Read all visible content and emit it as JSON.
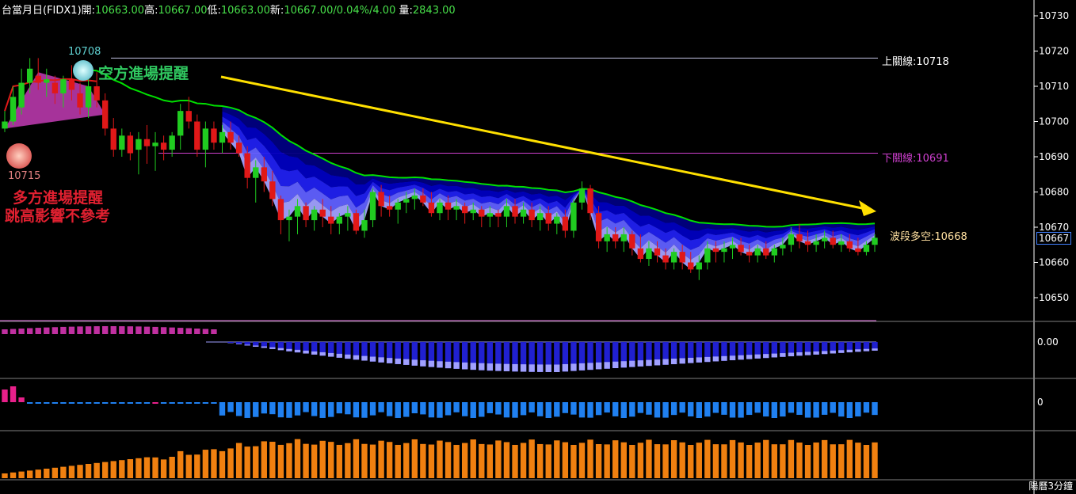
{
  "header": {
    "title": "台當月日(FIDX1)",
    "open_label": "開:",
    "open": "10663.00",
    "high_label": "高:",
    "high": "10667.00",
    "low_label": "低:",
    "low": "10663.00",
    "new_label": "新:",
    "new": "10667.00/0.04%/4.00",
    "vol_label": "量:",
    "vol": "2843.00"
  },
  "annotations": {
    "short_alert": "空方進場提醒",
    "short_price": "10708",
    "long_alert_line1": "多方進場提醒",
    "long_alert_line2": "跳高影響不參考",
    "long_price": "10715",
    "upper_line": "上關線:10718",
    "lower_line": "下關線:10691",
    "wave": "波段多空:10668",
    "current_price": "10667"
  },
  "footer": {
    "mode": "陽曆3分鐘"
  },
  "colors": {
    "bull": "#20cc20",
    "bear": "#e01818",
    "trend": "#ffe000",
    "ma": "#00e000",
    "upper": "#c0c0e0",
    "lower": "#d040d0",
    "hist_pos": "#e8208a",
    "hist_neg": "#2080f0",
    "volume": "#f08010"
  },
  "chart_data": {
    "type": "candlestick",
    "yticks": [
      10730,
      10720,
      10710,
      10700,
      10690,
      10680,
      10670,
      10660,
      10650
    ],
    "ylim": [
      10642,
      10733
    ],
    "osc_tick": "0.00",
    "hist_tick": "0",
    "upper_level": 10718,
    "lower_level": 10691,
    "wave_level": 10668,
    "current": 10667,
    "wave_label_price": 10668,
    "trend": {
      "from_index": 60,
      "from_price": 10713,
      "to_index": 1105,
      "to_price": 10672
    },
    "candles": [
      [
        10698,
        10703,
        10697,
        10700
      ],
      [
        10700,
        10710,
        10699,
        10707
      ],
      [
        10704,
        10715,
        10702,
        10711
      ],
      [
        10711,
        10718,
        10708,
        10715
      ],
      [
        10713,
        10718,
        10709,
        10711
      ],
      [
        10711,
        10715,
        10707,
        10712
      ],
      [
        10711,
        10713,
        10705,
        10708
      ],
      [
        10708,
        10713,
        10704,
        10712
      ],
      [
        10712,
        10716,
        10706,
        10709
      ],
      [
        10708,
        10711,
        10702,
        10704
      ],
      [
        10704,
        10712,
        10701,
        10710
      ],
      [
        10710,
        10714,
        10704,
        10706
      ],
      [
        10706,
        10708,
        10696,
        10698
      ],
      [
        10698,
        10701,
        10690,
        10692
      ],
      [
        10692,
        10698,
        10690,
        10696
      ],
      [
        10696,
        10697,
        10689,
        10691
      ],
      [
        10692,
        10697,
        10685,
        10695
      ],
      [
        10695,
        10699,
        10688,
        10693
      ],
      [
        10693,
        10697,
        10686,
        10694
      ],
      [
        10694,
        10696,
        10689,
        10692
      ],
      [
        10692,
        10697,
        10690,
        10696
      ],
      [
        10696,
        10705,
        10692,
        10703
      ],
      [
        10703,
        10707,
        10698,
        10700
      ],
      [
        10700,
        10702,
        10690,
        10692
      ],
      [
        10692,
        10700,
        10687,
        10698
      ],
      [
        10698,
        10700,
        10692,
        10694
      ],
      [
        10694,
        10699,
        10691,
        10697
      ],
      [
        10697,
        10700,
        10692,
        10694
      ],
      [
        10694,
        10696,
        10690,
        10691
      ],
      [
        10691,
        10693,
        10681,
        10684
      ],
      [
        10684,
        10689,
        10677,
        10687
      ],
      [
        10687,
        10690,
        10680,
        10683
      ],
      [
        10683,
        10686,
        10676,
        10678
      ],
      [
        10678,
        10679,
        10668,
        10672
      ],
      [
        10672,
        10675,
        10666,
        10673
      ],
      [
        10673,
        10678,
        10668,
        10676
      ],
      [
        10676,
        10677,
        10670,
        10672
      ],
      [
        10672,
        10676,
        10669,
        10675
      ],
      [
        10675,
        10678,
        10670,
        10673
      ],
      [
        10673,
        10676,
        10668,
        10671
      ],
      [
        10671,
        10674,
        10668,
        10673
      ],
      [
        10673,
        10676,
        10669,
        10674
      ],
      [
        10674,
        10675,
        10668,
        10669
      ],
      [
        10669,
        10675,
        10667,
        10672
      ],
      [
        10672,
        10681,
        10670,
        10680
      ],
      [
        10680,
        10682,
        10673,
        10676
      ],
      [
        10676,
        10679,
        10673,
        10675
      ],
      [
        10675,
        10678,
        10671,
        10677
      ],
      [
        10677,
        10680,
        10674,
        10678
      ],
      [
        10678,
        10681,
        10675,
        10679
      ],
      [
        10679,
        10681,
        10676,
        10677
      ],
      [
        10677,
        10680,
        10673,
        10674
      ],
      [
        10674,
        10678,
        10672,
        10677
      ],
      [
        10677,
        10679,
        10672,
        10675
      ],
      [
        10675,
        10678,
        10672,
        10676
      ],
      [
        10676,
        10677,
        10671,
        10674
      ],
      [
        10674,
        10677,
        10672,
        10675
      ],
      [
        10675,
        10676,
        10670,
        10673
      ],
      [
        10673,
        10676,
        10670,
        10674
      ],
      [
        10674,
        10675,
        10670,
        10673
      ],
      [
        10673,
        10678,
        10670,
        10676
      ],
      [
        10676,
        10678,
        10671,
        10673
      ],
      [
        10673,
        10677,
        10671,
        10675
      ],
      [
        10675,
        10677,
        10670,
        10672
      ],
      [
        10672,
        10676,
        10669,
        10674
      ],
      [
        10674,
        10676,
        10669,
        10671
      ],
      [
        10671,
        10674,
        10668,
        10673
      ],
      [
        10673,
        10675,
        10667,
        10669
      ],
      [
        10669,
        10678,
        10667,
        10677
      ],
      [
        10677,
        10683,
        10675,
        10681
      ],
      [
        10681,
        10682,
        10672,
        10674
      ],
      [
        10674,
        10676,
        10664,
        10666
      ],
      [
        10666,
        10670,
        10663,
        10668
      ],
      [
        10668,
        10670,
        10664,
        10666
      ],
      [
        10666,
        10670,
        10663,
        10668
      ],
      [
        10668,
        10669,
        10662,
        10664
      ],
      [
        10664,
        10668,
        10660,
        10661
      ],
      [
        10661,
        10666,
        10659,
        10664
      ],
      [
        10664,
        10666,
        10660,
        10662
      ],
      [
        10662,
        10664,
        10658,
        10660
      ],
      [
        10660,
        10664,
        10658,
        10663
      ],
      [
        10663,
        10665,
        10658,
        10660
      ],
      [
        10660,
        10663,
        10657,
        10658
      ],
      [
        10658,
        10662,
        10655,
        10660
      ],
      [
        10660,
        10666,
        10658,
        10664
      ],
      [
        10664,
        10666,
        10660,
        10663
      ],
      [
        10663,
        10666,
        10660,
        10664
      ],
      [
        10664,
        10667,
        10661,
        10665
      ],
      [
        10665,
        10667,
        10662,
        10663
      ],
      [
        10663,
        10665,
        10660,
        10662
      ],
      [
        10662,
        10665,
        10660,
        10664
      ],
      [
        10664,
        10666,
        10661,
        10662
      ],
      [
        10662,
        10665,
        10660,
        10664
      ],
      [
        10664,
        10667,
        10662,
        10665
      ],
      [
        10665,
        10670,
        10663,
        10668
      ],
      [
        10668,
        10671,
        10664,
        10666
      ],
      [
        10666,
        10669,
        10663,
        10665
      ],
      [
        10665,
        10668,
        10663,
        10666
      ],
      [
        10666,
        10669,
        10664,
        10667
      ],
      [
        10667,
        10669,
        10664,
        10665
      ],
      [
        10665,
        10668,
        10663,
        10666
      ],
      [
        10666,
        10668,
        10663,
        10664
      ],
      [
        10664,
        10667,
        10662,
        10663
      ],
      [
        10663,
        10666,
        10662,
        10665
      ],
      [
        10665,
        10668,
        10663,
        10667
      ]
    ],
    "oscillator": [],
    "histogram": [],
    "volume": []
  }
}
